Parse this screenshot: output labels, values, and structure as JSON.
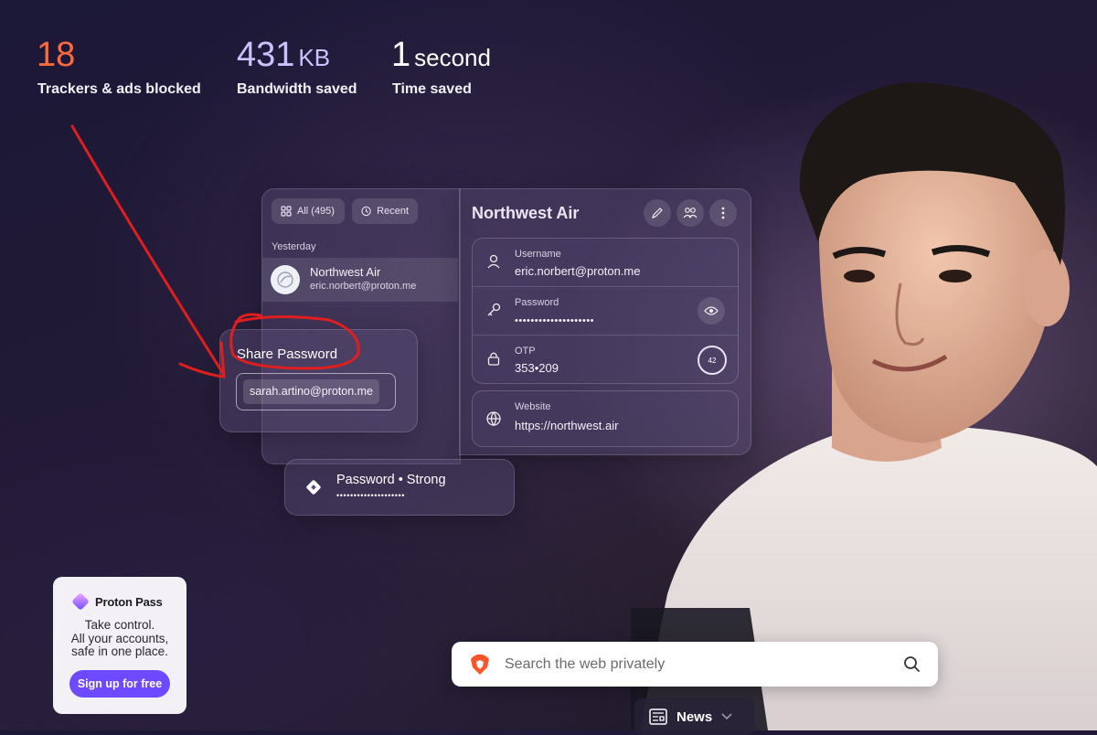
{
  "stats": [
    {
      "value": "18",
      "unit": "",
      "label": "Trackers & ads blocked",
      "color": "#ff6a3d"
    },
    {
      "value": "431",
      "unit": "KB",
      "label": "Bandwidth saved",
      "color": "#c9c3ff"
    },
    {
      "value": "1",
      "unit": "second",
      "label": "Time saved",
      "color": "#ffffff"
    }
  ],
  "vault": {
    "filter_all": "All (495)",
    "filter_recent": "Recent",
    "group_label": "Yesterday",
    "item": {
      "title": "Northwest Air",
      "subtitle": "eric.norbert@proton.me"
    }
  },
  "detail": {
    "title": "Northwest Air",
    "username_label": "Username",
    "username_value": "eric.norbert@proton.me",
    "password_label": "Password",
    "password_value": "••••••••••••••••••••",
    "otp_label": "OTP",
    "otp_value": "353•209",
    "otp_timer": "42",
    "website_label": "Website",
    "website_value": "https://northwest.air"
  },
  "share": {
    "title": "Share Password",
    "email": "sarah.artino@proton.me"
  },
  "strength": {
    "label": "Password • Strong",
    "dots": "••••••••••••••••••••"
  },
  "ad": {
    "brand": "Proton Pass",
    "tagline": [
      "Take control.",
      "All your accounts,",
      "safe in one place."
    ],
    "cta": "Sign up for free"
  },
  "search": {
    "placeholder": "Search the web privately"
  },
  "news": {
    "label": "News"
  },
  "colors": {
    "accent_orange": "#ff6a3d",
    "accent_lavender": "#c9c3ff",
    "proton_purple": "#6d4aff",
    "annotation_red": "#e01e1e"
  }
}
